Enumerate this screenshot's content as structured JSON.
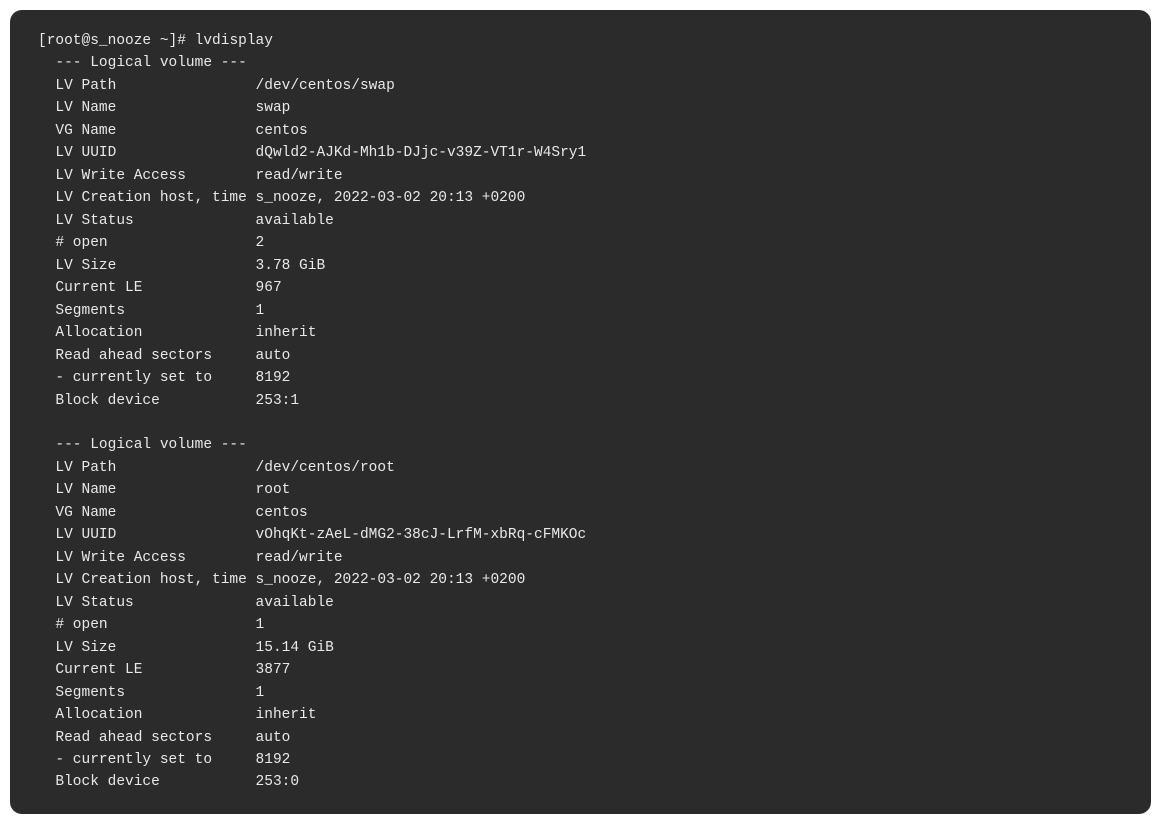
{
  "prompt": "[root@s_nooze ~]# ",
  "command": "lvdisplay",
  "volume_header": "  --- Logical volume ---",
  "volumes": [
    {
      "fields": [
        {
          "label": "  LV Path",
          "value": "/dev/centos/swap"
        },
        {
          "label": "  LV Name",
          "value": "swap"
        },
        {
          "label": "  VG Name",
          "value": "centos"
        },
        {
          "label": "  LV UUID",
          "value": "dQwld2-AJKd-Mh1b-DJjc-v39Z-VT1r-W4Sry1"
        },
        {
          "label": "  LV Write Access",
          "value": "read/write"
        },
        {
          "label": "  LV Creation host, time",
          "value": "s_nooze, 2022-03-02 20:13 +0200"
        },
        {
          "label": "  LV Status",
          "value": "available"
        },
        {
          "label": "  # open",
          "value": "2"
        },
        {
          "label": "  LV Size",
          "value": "3.78 GiB"
        },
        {
          "label": "  Current LE",
          "value": "967"
        },
        {
          "label": "  Segments",
          "value": "1"
        },
        {
          "label": "  Allocation",
          "value": "inherit"
        },
        {
          "label": "  Read ahead sectors",
          "value": "auto"
        },
        {
          "label": "  - currently set to",
          "value": "8192"
        },
        {
          "label": "  Block device",
          "value": "253:1"
        }
      ]
    },
    {
      "fields": [
        {
          "label": "  LV Path",
          "value": "/dev/centos/root"
        },
        {
          "label": "  LV Name",
          "value": "root"
        },
        {
          "label": "  VG Name",
          "value": "centos"
        },
        {
          "label": "  LV UUID",
          "value": "vOhqKt-zAeL-dMG2-38cJ-LrfM-xbRq-cFMKOc"
        },
        {
          "label": "  LV Write Access",
          "value": "read/write"
        },
        {
          "label": "  LV Creation host, time",
          "value": "s_nooze, 2022-03-02 20:13 +0200"
        },
        {
          "label": "  LV Status",
          "value": "available"
        },
        {
          "label": "  # open",
          "value": "1"
        },
        {
          "label": "  LV Size",
          "value": "15.14 GiB"
        },
        {
          "label": "  Current LE",
          "value": "3877"
        },
        {
          "label": "  Segments",
          "value": "1"
        },
        {
          "label": "  Allocation",
          "value": "inherit"
        },
        {
          "label": "  Read ahead sectors",
          "value": "auto"
        },
        {
          "label": "  - currently set to",
          "value": "8192"
        },
        {
          "label": "  Block device",
          "value": "253:0"
        }
      ]
    }
  ]
}
